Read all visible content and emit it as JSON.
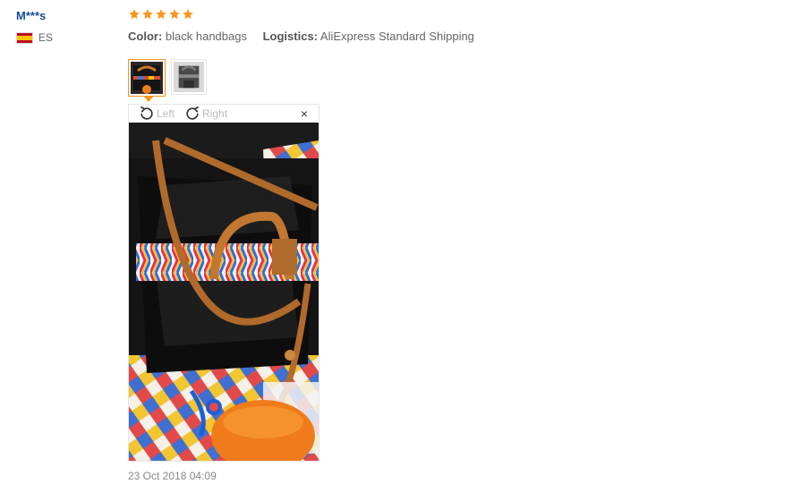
{
  "reviewer": {
    "name": "M***s",
    "country_code": "ES"
  },
  "review": {
    "rating": 5,
    "color_label": "Color:",
    "color_value": "black handbags",
    "logistics_label": "Logistics:",
    "logistics_value": "AliExpress Standard Shipping",
    "date": "23 Oct 2018 04:09"
  },
  "photo_viewer": {
    "rotate_left_label": "Left",
    "rotate_right_label": "Right",
    "close_symbol": "×",
    "selected_thumbnail_index": 0,
    "thumbnail_count": 2
  },
  "colors": {
    "accent": "#f7941d",
    "name_link": "#1a4c9c",
    "muted_text": "#666666"
  },
  "icons": {
    "star": "star-icon",
    "flag": "spain-flag-icon",
    "rotate_left": "rotate-left-icon",
    "rotate_right": "rotate-right-icon",
    "close": "close-icon"
  }
}
